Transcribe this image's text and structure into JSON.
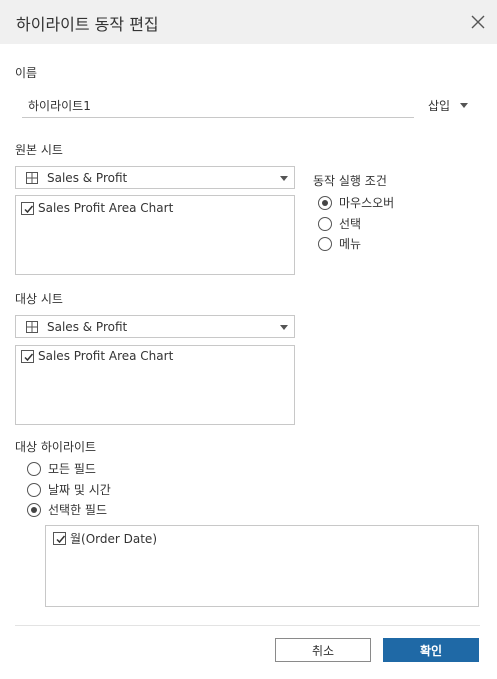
{
  "dialog": {
    "title": "하이라이트 동작 편집"
  },
  "name_section": {
    "label": "이름",
    "value": "하이라이트1",
    "insert_label": "삽입"
  },
  "source": {
    "label": "원본 시트",
    "datasource": "Sales & Profit",
    "sheets": [
      {
        "label": "Sales Profit Area Chart",
        "checked": true
      }
    ]
  },
  "trigger": {
    "label": "동작 실행 조건",
    "options": [
      {
        "label": "마우스오버",
        "selected": true
      },
      {
        "label": "선택",
        "selected": false
      },
      {
        "label": "메뉴",
        "selected": false
      }
    ]
  },
  "target": {
    "label": "대상 시트",
    "datasource": "Sales & Profit",
    "sheets": [
      {
        "label": "Sales Profit Area Chart",
        "checked": true
      }
    ]
  },
  "target_highlight": {
    "label": "대상 하이라이트",
    "options": [
      {
        "label": "모든 필드",
        "selected": false
      },
      {
        "label": "날짜 및 시간",
        "selected": false
      },
      {
        "label": "선택한 필드",
        "selected": true
      }
    ],
    "fields": [
      {
        "label": "월(Order Date)",
        "checked": true
      }
    ]
  },
  "buttons": {
    "cancel": "취소",
    "ok": "확인"
  },
  "colors": {
    "primary": "#1f69a6",
    "titlebar": "#f0f0f0",
    "border": "#c8c8c8"
  }
}
